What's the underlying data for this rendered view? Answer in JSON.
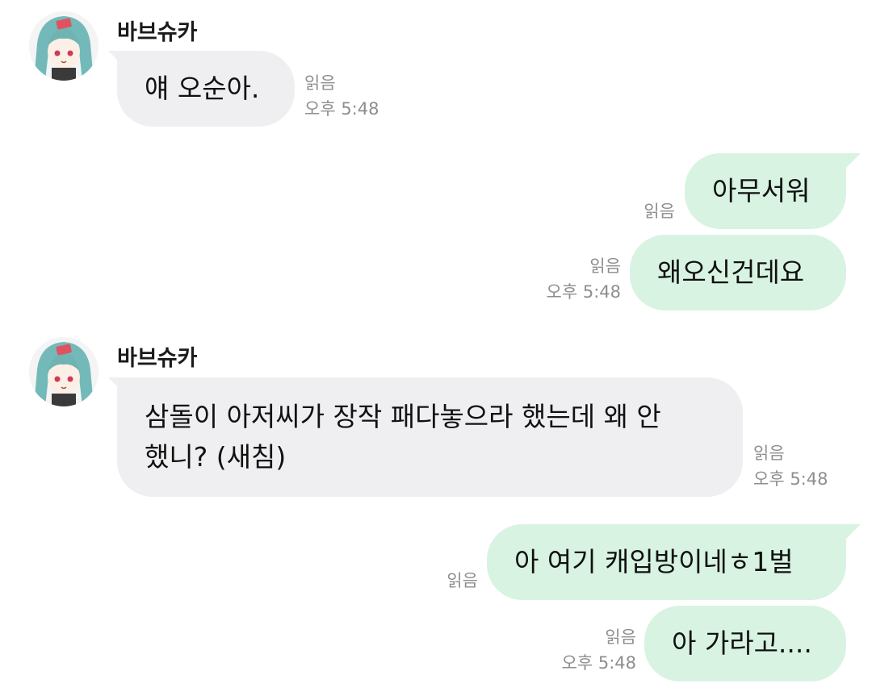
{
  "chat": {
    "colors": {
      "incoming_bubble": "#efeff1",
      "outgoing_bubble": "#d8f3e2",
      "meta_text": "#8e8e8e"
    },
    "messages": [
      {
        "sender": "바브슈카",
        "direction": "incoming",
        "text": "얘 오순아.",
        "read": "읽음",
        "time": "오후 5:48"
      },
      {
        "direction": "outgoing",
        "text": "아무서워",
        "read": "읽음"
      },
      {
        "direction": "outgoing",
        "text": "왜오신건데요",
        "read": "읽음",
        "time": "오후 5:48"
      },
      {
        "sender": "바브슈카",
        "direction": "incoming",
        "text": "삼돌이 아저씨가 장작 패다놓으라 했는데 왜 안\n했니? (새침)",
        "read": "읽음",
        "time": "오후 5:48"
      },
      {
        "direction": "outgoing",
        "text": "아 여기 캐입방이네ㅎ1벌",
        "read": "읽음"
      },
      {
        "direction": "outgoing",
        "text": "아 가라고....",
        "read": "읽음",
        "time": "오후 5:48"
      }
    ]
  }
}
